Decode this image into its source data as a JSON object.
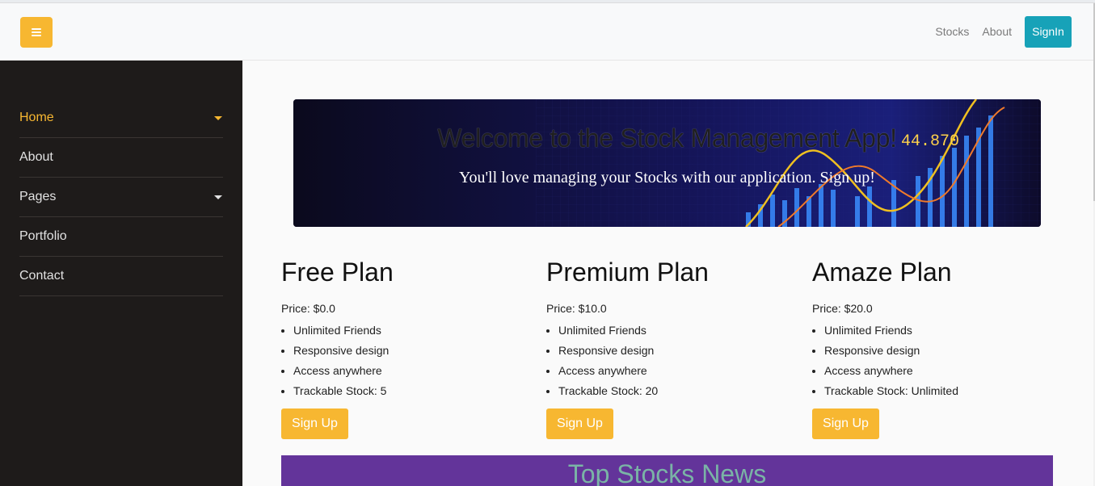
{
  "navbar": {
    "toggle_icon": "hamburger-icon",
    "links": [
      "Stocks",
      "About"
    ],
    "signin_label": "SignIn"
  },
  "sidebar": {
    "items": [
      {
        "label": "Home",
        "active": true,
        "has_dropdown": true
      },
      {
        "label": "About",
        "active": false,
        "has_dropdown": false
      },
      {
        "label": "Pages",
        "active": false,
        "has_dropdown": true
      },
      {
        "label": "Portfolio",
        "active": false,
        "has_dropdown": false
      },
      {
        "label": "Contact",
        "active": false,
        "has_dropdown": false
      }
    ]
  },
  "hero": {
    "title": "Welcome to the Stock Management App!",
    "subtitle": "You'll love managing your Stocks with our application. Sign up!",
    "ticker_value": "44.870"
  },
  "plans": [
    {
      "name": "Free Plan",
      "price": "Price: $0.0",
      "features": [
        "Unlimited Friends",
        "Responsive design",
        "Access anywhere",
        "Trackable Stock: 5"
      ],
      "button": "Sign Up"
    },
    {
      "name": "Premium Plan",
      "price": "Price: $10.0",
      "features": [
        "Unlimited Friends",
        "Responsive design",
        "Access anywhere",
        "Trackable Stock: 20"
      ],
      "button": "Sign Up"
    },
    {
      "name": "Amaze Plan",
      "price": "Price: $20.0",
      "features": [
        "Unlimited Friends",
        "Responsive design",
        "Access anywhere",
        "Trackable Stock: Unlimited"
      ],
      "button": "Sign Up"
    }
  ],
  "news": {
    "title": "Top Stocks News"
  },
  "colors": {
    "accent": "#f7b731",
    "signin": "#17a2b8",
    "sidebar_bg": "#1e1b1a",
    "news_bg": "#63349a"
  }
}
